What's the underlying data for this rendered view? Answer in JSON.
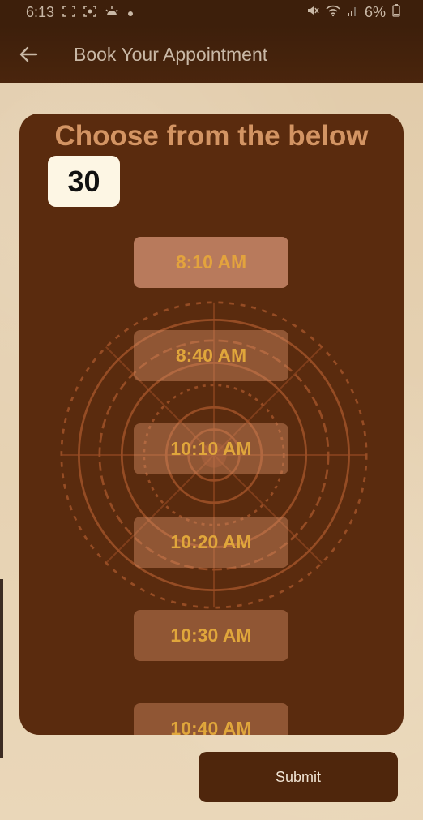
{
  "status_bar": {
    "time": "6:13",
    "battery": "6%",
    "left_icons": [
      "screenshot-icon",
      "scan-icon",
      "weather-icon",
      "dot-icon"
    ],
    "right_icons": [
      "mute-icon",
      "wifi-icon",
      "signal-icon",
      "battery-icon"
    ]
  },
  "app_bar": {
    "title": "Book Your Appointment",
    "back_icon": "back-arrow-icon"
  },
  "card": {
    "heading": "Choose from the below",
    "duration": "30"
  },
  "slots": [
    {
      "label": "8:10 AM",
      "selected": true
    },
    {
      "label": "8:40 AM",
      "selected": false
    },
    {
      "label": "10:10 AM",
      "selected": false
    },
    {
      "label": "10:20 AM",
      "selected": false
    },
    {
      "label": "10:30 AM",
      "selected": false
    },
    {
      "label": "10:40 AM",
      "selected": false
    }
  ],
  "submit_label": "Submit",
  "colors": {
    "app_bar": "#3d1f0b",
    "card": "#5a2b0e",
    "slot_text": "#e0a63b",
    "heading": "#d39463",
    "submit": "#4f260c"
  }
}
